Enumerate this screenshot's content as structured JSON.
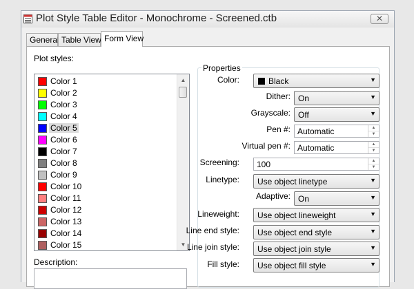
{
  "window": {
    "title": "Plot Style Table Editor - Monochrome - Screened.ctb",
    "close_glyph": "✕",
    "icon": "table-editor-icon"
  },
  "tabs": [
    "General",
    "Table View",
    "Form View"
  ],
  "active_tab": "Form View",
  "plot_styles": {
    "label": "Plot styles:",
    "selected": "Color 5",
    "items": [
      {
        "label": "Color 1",
        "color": "#ff0000"
      },
      {
        "label": "Color 2",
        "color": "#ffff00"
      },
      {
        "label": "Color 3",
        "color": "#00ff00"
      },
      {
        "label": "Color 4",
        "color": "#00ffff"
      },
      {
        "label": "Color 5",
        "color": "#0000ff"
      },
      {
        "label": "Color 6",
        "color": "#ff00ff"
      },
      {
        "label": "Color 7",
        "color": "#000000"
      },
      {
        "label": "Color 8",
        "color": "#808080"
      },
      {
        "label": "Color 9",
        "color": "#c0c0c0"
      },
      {
        "label": "Color 10",
        "color": "#ff0000"
      },
      {
        "label": "Color 11",
        "color": "#ff7f7f"
      },
      {
        "label": "Color 12",
        "color": "#cc0000"
      },
      {
        "label": "Color 13",
        "color": "#cc6666"
      },
      {
        "label": "Color 14",
        "color": "#990000"
      },
      {
        "label": "Color 15",
        "color": "#b06060"
      }
    ]
  },
  "description": {
    "label": "Description:",
    "value": ""
  },
  "properties": {
    "title": "Properties",
    "color": {
      "label": "Color:",
      "value": "Black",
      "chip_color": "#000000"
    },
    "dither": {
      "label": "Dither:",
      "value": "On"
    },
    "grayscale": {
      "label": "Grayscale:",
      "value": "Off"
    },
    "pen": {
      "label": "Pen #:",
      "value": "Automatic"
    },
    "virtual_pen": {
      "label": "Virtual pen #:",
      "value": "Automatic"
    },
    "screening": {
      "label": "Screening:",
      "value": "100"
    },
    "linetype": {
      "label": "Linetype:",
      "value": "Use object linetype"
    },
    "adaptive": {
      "label": "Adaptive:",
      "value": "On"
    },
    "lineweight": {
      "label": "Lineweight:",
      "value": "Use object lineweight"
    },
    "line_end": {
      "label": "Line end style:",
      "value": "Use object end style"
    },
    "line_join": {
      "label": "Line join style:",
      "value": "Use object join style"
    },
    "fill": {
      "label": "Fill style:",
      "value": "Use object fill style"
    }
  }
}
